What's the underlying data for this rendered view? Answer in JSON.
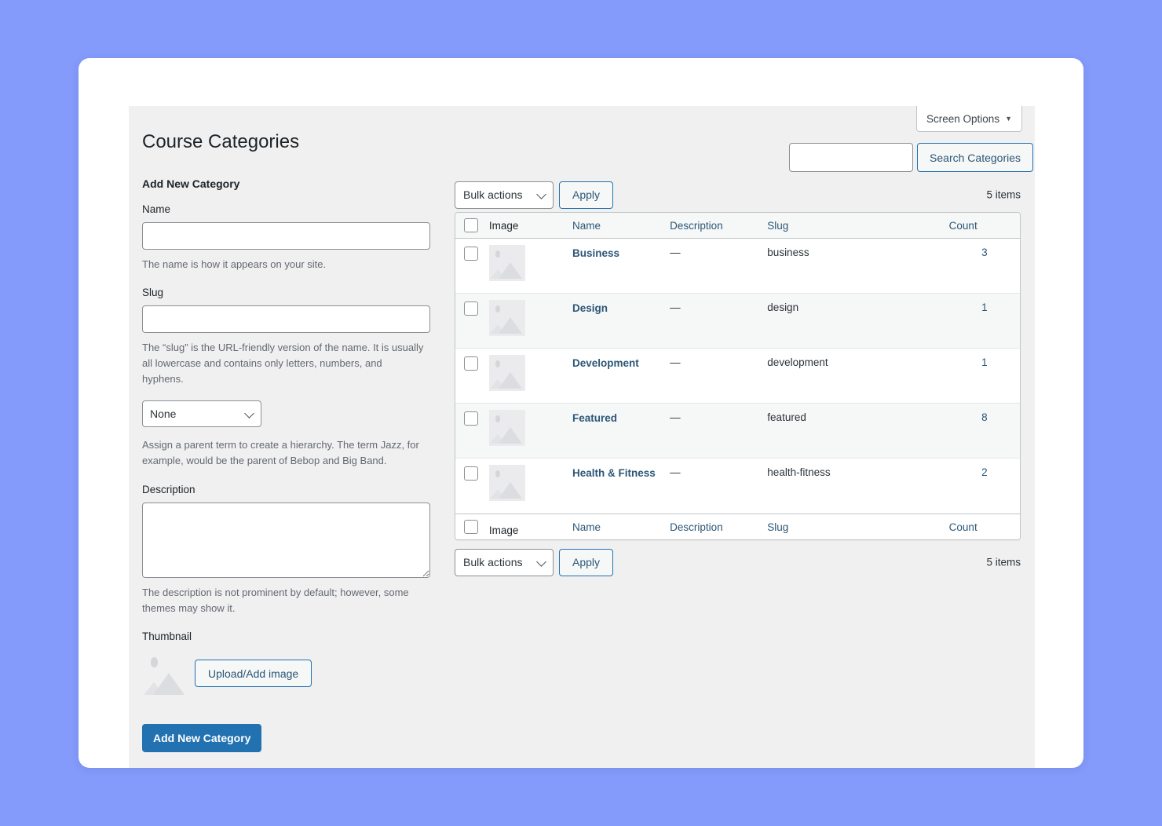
{
  "page": {
    "title": "Course Categories",
    "screen_options_label": "Screen Options",
    "screen_options_caret": "▼"
  },
  "search": {
    "value": "",
    "placeholder": "",
    "button_label": "Search Categories"
  },
  "form": {
    "heading": "Add New Category",
    "name_label": "Name",
    "name_value": "",
    "name_help": "The name is how it appears on your site.",
    "slug_label": "Slug",
    "slug_value": "",
    "slug_help": "The “slug” is the URL-friendly version of the name. It is usually all lowercase and contains only letters, numbers, and hyphens.",
    "parent_selected": "None",
    "parent_options": [
      "None"
    ],
    "parent_help": "Assign a parent term to create a hierarchy. The term Jazz, for example, would be the parent of Bebop and Big Band.",
    "description_label": "Description",
    "description_value": "",
    "description_help": "The description is not prominent by default; however, some themes may show it.",
    "thumbnail_label": "Thumbnail",
    "upload_button_label": "Upload/Add image",
    "submit_label": "Add New Category"
  },
  "tablenav_top": {
    "bulk_selected": "Bulk actions",
    "bulk_options": [
      "Bulk actions"
    ],
    "apply_label": "Apply",
    "items_count": "5 items"
  },
  "tablenav_bottom": {
    "bulk_selected": "Bulk actions",
    "bulk_options": [
      "Bulk actions"
    ],
    "apply_label": "Apply",
    "items_count": "5 items"
  },
  "table": {
    "columns": [
      {
        "key": "image",
        "label": "Image",
        "is_link": false
      },
      {
        "key": "name",
        "label": "Name",
        "is_link": true
      },
      {
        "key": "description",
        "label": "Description",
        "is_link": true
      },
      {
        "key": "slug",
        "label": "Slug",
        "is_link": true
      },
      {
        "key": "count",
        "label": "Count",
        "is_link": true
      }
    ],
    "rows": [
      {
        "image": "image-placeholder-icon",
        "name": "Business",
        "description": "—",
        "slug": "business",
        "count": "3"
      },
      {
        "image": "image-placeholder-icon",
        "name": "Design",
        "description": "—",
        "slug": "design",
        "count": "1"
      },
      {
        "image": "image-placeholder-icon",
        "name": "Development",
        "description": "—",
        "slug": "development",
        "count": "1"
      },
      {
        "image": "image-placeholder-icon",
        "name": "Featured",
        "description": "—",
        "slug": "featured",
        "count": "8"
      },
      {
        "image": "image-placeholder-icon",
        "name": "Health & Fitness",
        "description": "—",
        "slug": "health-fitness",
        "count": "2"
      }
    ]
  },
  "colors": {
    "page_background": "#849bfb",
    "card_background": "#ffffff",
    "admin_background": "#f0f0f1",
    "link": "#2c5777",
    "primary_button": "#2271b1",
    "table_header": "#f6f7f7",
    "border": "#c3c4c7"
  }
}
